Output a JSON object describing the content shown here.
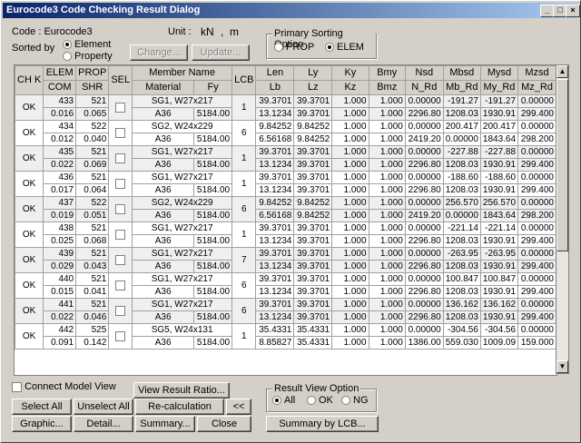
{
  "window": {
    "title": "Eurocode3 Code Checking Result Dialog"
  },
  "code_label": "Code : Eurocode3",
  "unit": {
    "label": "Unit :",
    "force": "kN",
    "sep": ",",
    "length": "m"
  },
  "sorted_by": {
    "label": "Sorted by",
    "element": "Element",
    "property": "Property",
    "selected": "Element"
  },
  "buttons_top": {
    "change": "Change...",
    "update": "Update..."
  },
  "primary_sort": {
    "title": "Primary Sorting Option",
    "prop": "PROP",
    "elem": "ELEM",
    "selected": "ELEM"
  },
  "headers": {
    "chk": "CH K",
    "elem": "ELEM",
    "com": "COM",
    "prop": "PROP",
    "shr": "SHR",
    "sel": "SEL",
    "member_name": "Member Name",
    "material": "Material",
    "fy": "Fy",
    "lcb": "LCB",
    "len": "Len",
    "lb": "Lb",
    "ly": "Ly",
    "lz": "Lz",
    "ky": "Ky",
    "kz": "Kz",
    "bmy": "Bmy",
    "bmz": "Bmz",
    "nsd": "Nsd",
    "n_rd": "N_Rd",
    "mbsd": "Mbsd",
    "mb_rd": "Mb_Rd",
    "mysd": "Mysd",
    "my_rd": "My_Rd",
    "mzsd": "Mzsd",
    "mz_rd": "Mz_Rd"
  },
  "rows": [
    {
      "chk": "OK",
      "elem": "433",
      "com": "0.016",
      "prop": "521",
      "shr": "0.065",
      "name": "SG1, W27x217",
      "material": "A36",
      "fy": "5184.00",
      "lcb": "1",
      "len": "39.3701",
      "lb": "13.1234",
      "ly": "39.3701",
      "lz": "39.3701",
      "ky": "1.000",
      "kz": "1.000",
      "bmy": "1.000",
      "bmz": "1.000",
      "nsd": "0.00000",
      "n_rd": "2296.80",
      "mbsd": "-191.27",
      "mb_rd": "1208.03",
      "mysd": "-191.27",
      "my_rd": "1930.91",
      "mzsd": "0.00000",
      "mz_rd": "299.400"
    },
    {
      "chk": "OK",
      "elem": "434",
      "com": "0.012",
      "prop": "522",
      "shr": "0.040",
      "name": "SG2, W24x229",
      "material": "A36",
      "fy": "5184.00",
      "lcb": "6",
      "len": "9.84252",
      "lb": "6.56168",
      "ly": "9.84252",
      "lz": "9.84252",
      "ky": "1.000",
      "kz": "1.000",
      "bmy": "1.000",
      "bmz": "1.000",
      "nsd": "0.00000",
      "n_rd": "2419.20",
      "mbsd": "200.417",
      "mb_rd": "0.00000",
      "mysd": "200.417",
      "my_rd": "1843.64",
      "mzsd": "0.00000",
      "mz_rd": "298.200"
    },
    {
      "chk": "OK",
      "elem": "435",
      "com": "0.022",
      "prop": "521",
      "shr": "0.069",
      "name": "SG1, W27x217",
      "material": "A36",
      "fy": "5184.00",
      "lcb": "1",
      "len": "39.3701",
      "lb": "13.1234",
      "ly": "39.3701",
      "lz": "39.3701",
      "ky": "1.000",
      "kz": "1.000",
      "bmy": "1.000",
      "bmz": "1.000",
      "nsd": "0.00000",
      "n_rd": "2296.80",
      "mbsd": "-227.88",
      "mb_rd": "1208.03",
      "mysd": "-227.88",
      "my_rd": "1930.91",
      "mzsd": "0.00000",
      "mz_rd": "299.400"
    },
    {
      "chk": "OK",
      "elem": "436",
      "com": "0.017",
      "prop": "521",
      "shr": "0.064",
      "name": "SG1, W27x217",
      "material": "A36",
      "fy": "5184.00",
      "lcb": "1",
      "len": "39.3701",
      "lb": "13.1234",
      "ly": "39.3701",
      "lz": "39.3701",
      "ky": "1.000",
      "kz": "1.000",
      "bmy": "1.000",
      "bmz": "1.000",
      "nsd": "0.00000",
      "n_rd": "2296.80",
      "mbsd": "-188.60",
      "mb_rd": "1208.03",
      "mysd": "-188.60",
      "my_rd": "1930.91",
      "mzsd": "0.00000",
      "mz_rd": "299.400"
    },
    {
      "chk": "OK",
      "elem": "437",
      "com": "0.019",
      "prop": "522",
      "shr": "0.051",
      "name": "SG2, W24x229",
      "material": "A36",
      "fy": "5184.00",
      "lcb": "6",
      "len": "9.84252",
      "lb": "6.56168",
      "ly": "9.84252",
      "lz": "9.84252",
      "ky": "1.000",
      "kz": "1.000",
      "bmy": "1.000",
      "bmz": "1.000",
      "nsd": "0.00000",
      "n_rd": "2419.20",
      "mbsd": "256.570",
      "mb_rd": "0.00000",
      "mysd": "256.570",
      "my_rd": "1843.64",
      "mzsd": "0.00000",
      "mz_rd": "298.200"
    },
    {
      "chk": "OK",
      "elem": "438",
      "com": "0.025",
      "prop": "521",
      "shr": "0.068",
      "name": "SG1, W27x217",
      "material": "A36",
      "fy": "5184.00",
      "lcb": "1",
      "len": "39.3701",
      "lb": "13.1234",
      "ly": "39.3701",
      "lz": "39.3701",
      "ky": "1.000",
      "kz": "1.000",
      "bmy": "1.000",
      "bmz": "1.000",
      "nsd": "0.00000",
      "n_rd": "2296.80",
      "mbsd": "-221.14",
      "mb_rd": "1208.03",
      "mysd": "-221.14",
      "my_rd": "1930.91",
      "mzsd": "0.00000",
      "mz_rd": "299.400"
    },
    {
      "chk": "OK",
      "elem": "439",
      "com": "0.029",
      "prop": "521",
      "shr": "0.043",
      "name": "SG1, W27x217",
      "material": "A36",
      "fy": "5184.00",
      "lcb": "7",
      "len": "39.3701",
      "lb": "13.1234",
      "ly": "39.3701",
      "lz": "39.3701",
      "ky": "1.000",
      "kz": "1.000",
      "bmy": "1.000",
      "bmz": "1.000",
      "nsd": "0.00000",
      "n_rd": "2296.80",
      "mbsd": "-263.95",
      "mb_rd": "1208.03",
      "mysd": "-263.95",
      "my_rd": "1930.91",
      "mzsd": "0.00000",
      "mz_rd": "299.400"
    },
    {
      "chk": "OK",
      "elem": "440",
      "com": "0.015",
      "prop": "521",
      "shr": "0.041",
      "name": "SG1, W27x217",
      "material": "A36",
      "fy": "5184.00",
      "lcb": "6",
      "len": "39.3701",
      "lb": "13.1234",
      "ly": "39.3701",
      "lz": "39.3701",
      "ky": "1.000",
      "kz": "1.000",
      "bmy": "1.000",
      "bmz": "1.000",
      "nsd": "0.00000",
      "n_rd": "2296.80",
      "mbsd": "100.847",
      "mb_rd": "1208.03",
      "mysd": "100.847",
      "my_rd": "1930.91",
      "mzsd": "0.00000",
      "mz_rd": "299.400"
    },
    {
      "chk": "OK",
      "elem": "441",
      "com": "0.022",
      "prop": "521",
      "shr": "0.046",
      "name": "SG1, W27x217",
      "material": "A36",
      "fy": "5184.00",
      "lcb": "6",
      "len": "39.3701",
      "lb": "13.1234",
      "ly": "39.3701",
      "lz": "39.3701",
      "ky": "1.000",
      "kz": "1.000",
      "bmy": "1.000",
      "bmz": "1.000",
      "nsd": "0.00000",
      "n_rd": "2296.80",
      "mbsd": "136.162",
      "mb_rd": "1208.03",
      "mysd": "136.162",
      "my_rd": "1930.91",
      "mzsd": "0.00000",
      "mz_rd": "299.400"
    },
    {
      "chk": "OK",
      "elem": "442",
      "com": "0.091",
      "prop": "525",
      "shr": "0.142",
      "name": "SG5, W24x131",
      "material": "A36",
      "fy": "5184.00",
      "lcb": "1",
      "len": "35.4331",
      "lb": "8.85827",
      "ly": "35.4331",
      "lz": "35.4331",
      "ky": "1.000",
      "kz": "1.000",
      "bmy": "1.000",
      "bmz": "1.000",
      "nsd": "0.00000",
      "n_rd": "1386.00",
      "mbsd": "-304.56",
      "mb_rd": "559.030",
      "mysd": "-304.56",
      "my_rd": "1009.09",
      "mzsd": "0.00000",
      "mz_rd": "159.000"
    }
  ],
  "connect_model_view": "Connect Model View",
  "view_result_ratio": "View Result Ratio...",
  "result_view": {
    "title": "Result View Option",
    "all": "All",
    "ok": "OK",
    "ng": "NG",
    "selected": "All"
  },
  "buttons_bottom": {
    "select_all": "Select All",
    "unselect_all": "Unselect All",
    "recalc": "Re-calculation",
    "collapse": "<<",
    "graphic": "Graphic...",
    "detail": "Detail...",
    "summary": "Summary...",
    "close": "Close",
    "summary_lcb": "Summary by LCB..."
  },
  "title_buttons": {
    "min": "_",
    "max": "□",
    "close": "×"
  }
}
